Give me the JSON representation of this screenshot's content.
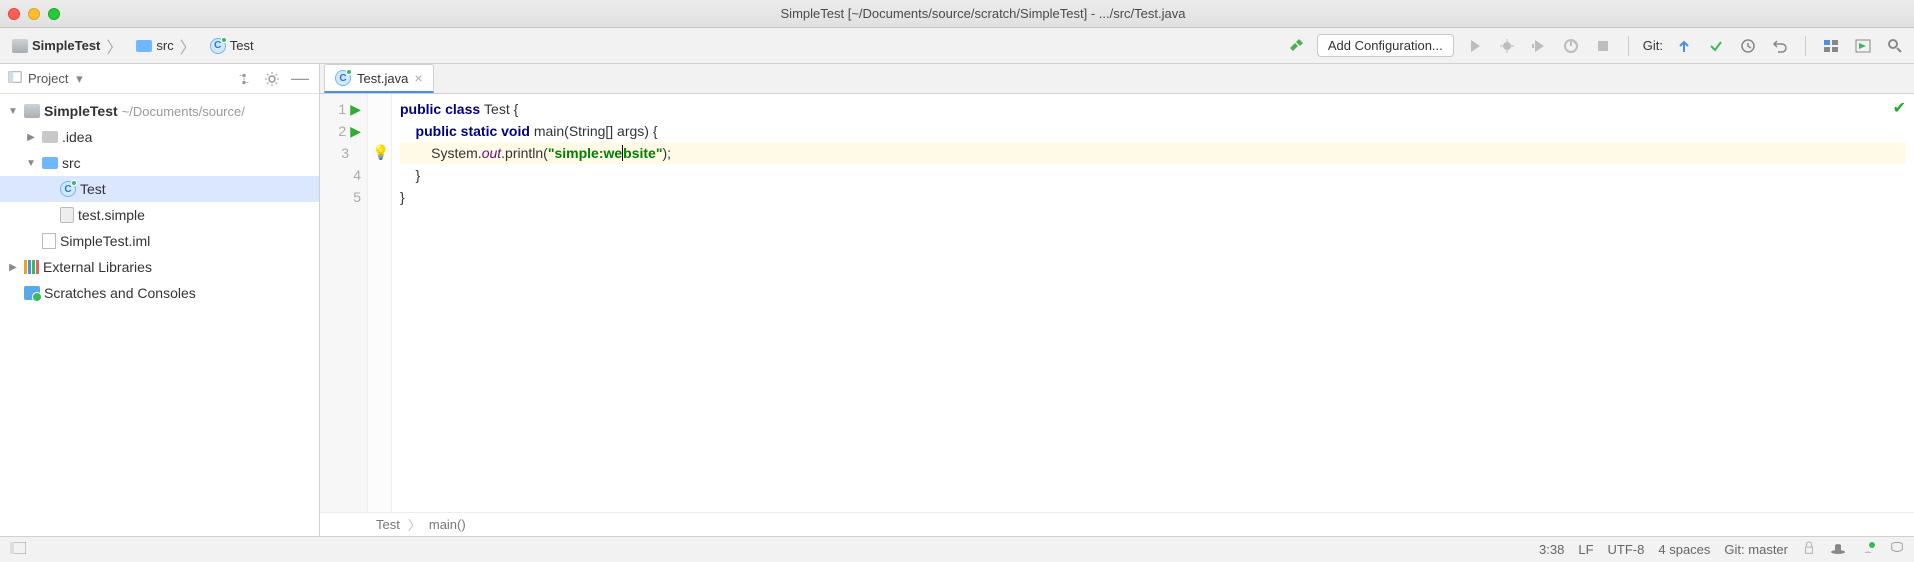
{
  "window_title": "SimpleTest [~/Documents/source/scratch/SimpleTest] - .../src/Test.java",
  "breadcrumb": {
    "project": "SimpleTest",
    "folder": "src",
    "file": "Test"
  },
  "toolbar": {
    "add_configuration": "Add Configuration...",
    "git_label": "Git:"
  },
  "sidebar": {
    "title": "Project",
    "tree": {
      "project_name": "SimpleTest",
      "project_path": "~/Documents/source/",
      "idea": ".idea",
      "src": "src",
      "test_class": "Test",
      "test_simple": "test.simple",
      "iml": "SimpleTest.iml",
      "ext_libs": "External Libraries",
      "scratches": "Scratches and Consoles"
    }
  },
  "tabs": {
    "active": "Test.java"
  },
  "code": {
    "line1_prefix": "public class ",
    "line1_name": "Test {",
    "line2_prefix": "    public static void ",
    "line2_name": "main(String[] args) {",
    "line3_sys": "        System.",
    "line3_out": "out",
    "line3_print": ".println(",
    "line3_str_a": "\"simple:we",
    "line3_str_b": "bsite\"",
    "line3_end": ");",
    "line4": "    }",
    "line5": "}"
  },
  "gutter": {
    "l1": "1",
    "l2": "2",
    "l3": "3",
    "l4": "4",
    "l5": "5"
  },
  "crumb_trail": {
    "a": "Test",
    "b": "main()"
  },
  "status": {
    "pos": "3:38",
    "eol": "LF",
    "enc": "UTF-8",
    "indent": "4 spaces",
    "git": "Git: master"
  }
}
